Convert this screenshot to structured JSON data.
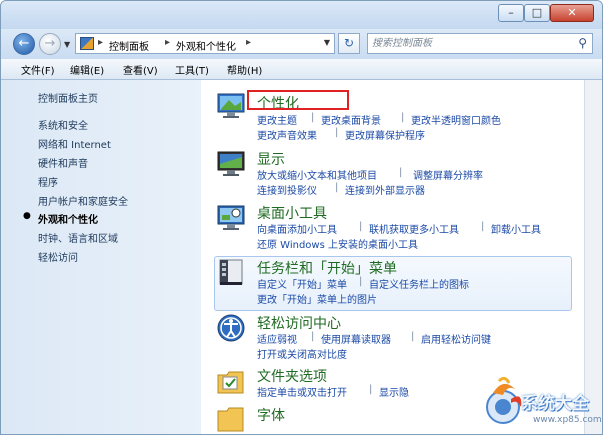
{
  "window": {
    "min_label": "–",
    "max_label": "□",
    "close_label": "✕"
  },
  "address": {
    "crumbs": [
      "控制面板",
      "外观和个性化"
    ],
    "search_placeholder": "搜索控制面板"
  },
  "menubar": [
    "文件(F)",
    "编辑(E)",
    "查看(V)",
    "工具(T)",
    "帮助(H)"
  ],
  "sidebar": {
    "home": "控制面板主页",
    "items": [
      "系统和安全",
      "网络和 Internet",
      "硬件和声音",
      "程序",
      "用户帐户和家庭安全",
      "外观和个性化",
      "时钟、语言和区域",
      "轻松访问"
    ],
    "current_index": 5
  },
  "categories": [
    {
      "title": "个性化",
      "icon": "personalization-icon",
      "links": [
        [
          "更改主题",
          "更改桌面背景",
          "更改半透明窗口颜色"
        ],
        [
          "更改声音效果",
          "更改屏幕保护程序"
        ]
      ]
    },
    {
      "title": "显示",
      "icon": "display-icon",
      "links": [
        [
          "放大或缩小文本和其他项目",
          "调整屏幕分辨率"
        ],
        [
          "连接到投影仪",
          "连接到外部显示器"
        ]
      ]
    },
    {
      "title": "桌面小工具",
      "icon": "gadgets-icon",
      "links": [
        [
          "向桌面添加小工具",
          "联机获取更多小工具",
          "卸载小工具"
        ],
        [
          "还原 Windows 上安装的桌面小工具"
        ]
      ]
    },
    {
      "title": "任务栏和「开始」菜单",
      "icon": "taskbar-icon",
      "links": [
        [
          "自定义「开始」菜单",
          "自定义任务栏上的图标"
        ],
        [
          "更改「开始」菜单上的图片"
        ]
      ]
    },
    {
      "title": "轻松访问中心",
      "icon": "ease-of-access-icon",
      "links": [
        [
          "适应弱视",
          "使用屏幕读取器",
          "启用轻松访问键"
        ],
        [
          "打开或关闭高对比度"
        ]
      ]
    },
    {
      "title": "文件夹选项",
      "icon": "folder-options-icon",
      "links": [
        [
          "指定单击或双击打开",
          "显示隐"
        ]
      ]
    },
    {
      "title": "字体",
      "icon": "fonts-icon",
      "links": []
    }
  ],
  "watermark": {
    "text": "系统大全",
    "sub": "www.xp85.com"
  }
}
